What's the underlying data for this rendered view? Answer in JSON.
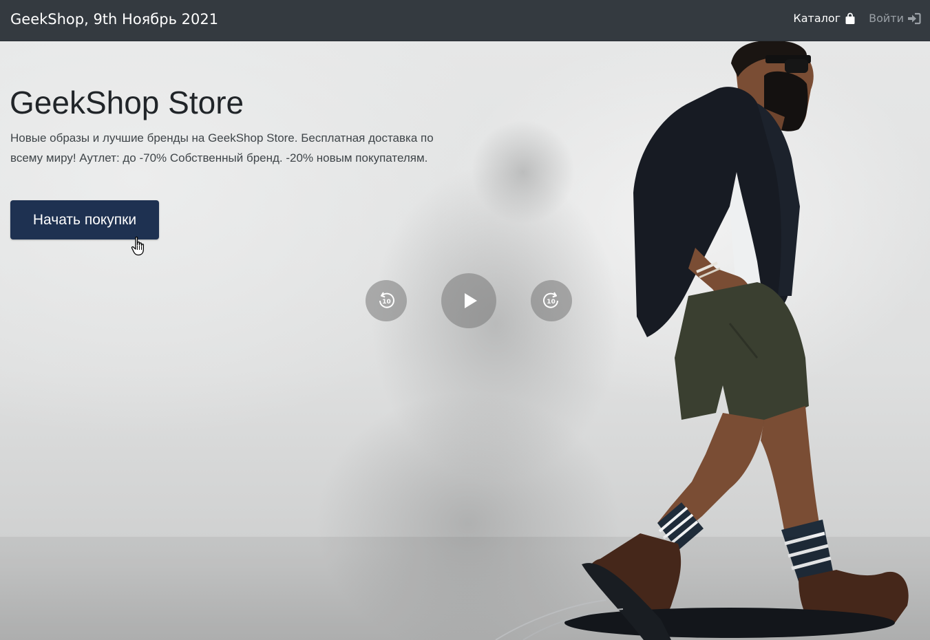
{
  "navbar": {
    "brand": "GeekShop, 9th Ноябрь 2021",
    "links": [
      {
        "label": "Каталог",
        "icon": "shopping-bag-icon",
        "active": true
      },
      {
        "label": "Войти",
        "icon": "sign-in-icon",
        "active": false
      }
    ]
  },
  "hero": {
    "title": "GeekShop Store",
    "description": "Новые образы и лучшие бренды на GeekShop Store. Бесплатная доставка по всему миру! Аутлет: до -70% Собственный бренд. -20% новым покупателям.",
    "cta_label": "Начать покупки"
  },
  "video_controls": {
    "rewind_seconds": "10",
    "forward_seconds": "10",
    "play_icon": "play-icon",
    "rewind_icon": "rewind-10-icon",
    "forward_icon": "forward-10-icon"
  },
  "colors": {
    "navbar_bg": "#343a40",
    "cta_bg": "#1e3151",
    "title_text": "#212529"
  }
}
